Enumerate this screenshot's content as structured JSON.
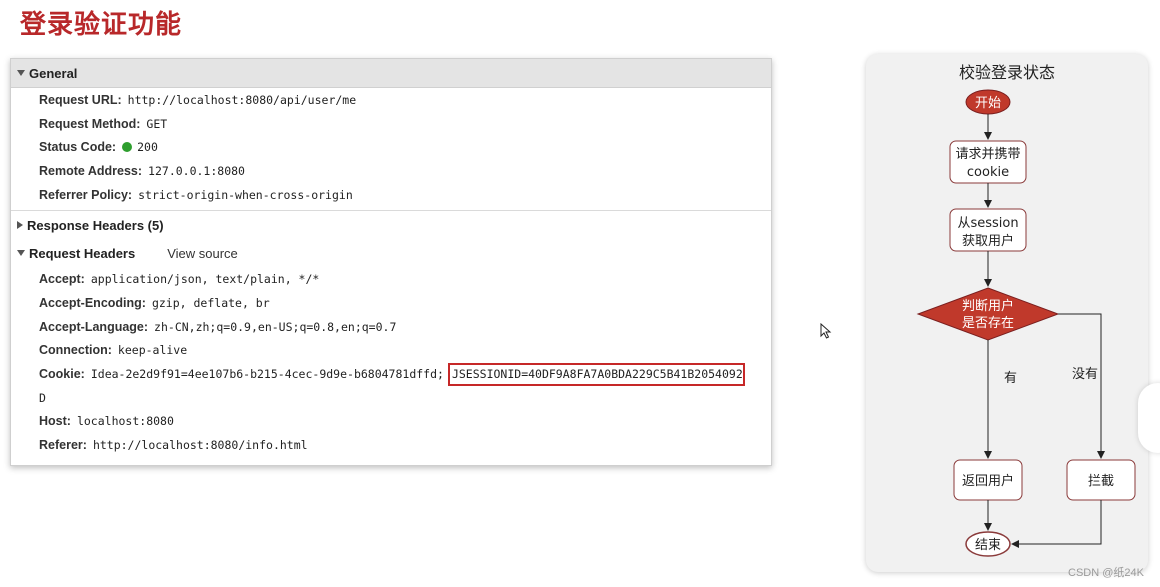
{
  "slide": {
    "title": "登录验证功能"
  },
  "devtools": {
    "general": {
      "title": "General",
      "rows": [
        {
          "key": "Request URL:",
          "value": "http://localhost:8080/api/user/me"
        },
        {
          "key": "Request Method:",
          "value": "GET"
        },
        {
          "key": "Status Code:",
          "value": "200"
        },
        {
          "key": "Remote Address:",
          "value": "127.0.0.1:8080"
        },
        {
          "key": "Referrer Policy:",
          "value": "strict-origin-when-cross-origin"
        }
      ]
    },
    "response_headers": {
      "title": "Response Headers (5)"
    },
    "request_headers": {
      "title": "Request Headers",
      "view_source": "View source",
      "rows": [
        {
          "key": "Accept:",
          "value": "application/json, text/plain, */*"
        },
        {
          "key": "Accept-Encoding:",
          "value": "gzip, deflate, br"
        },
        {
          "key": "Accept-Language:",
          "value": "zh-CN,zh;q=0.9,en-US;q=0.8,en;q=0.7"
        },
        {
          "key": "Connection:",
          "value": "keep-alive"
        },
        {
          "key": "Cookie:",
          "value": "Idea-2e2d9f91=4ee107b6-b215-4cec-9d9e-b6804781dffd;",
          "highlight": "JSESSIONID=40DF9A8FA7A0BDA229C5B41B2054092",
          "wrap": "D"
        },
        {
          "key": "Host:",
          "value": "localhost:8080"
        },
        {
          "key": "Referer:",
          "value": "http://localhost:8080/info.html"
        }
      ]
    }
  },
  "flowchart": {
    "title": "校验登录状态",
    "start": "开始",
    "step1": [
      "请求并携带",
      "cookie"
    ],
    "step2": [
      "从session",
      "获取用户"
    ],
    "decision": [
      "判断用户",
      "是否存在"
    ],
    "yes_label": "有",
    "no_label": "没有",
    "return_user": "返回用户",
    "intercept": "拦截",
    "end": "结束"
  },
  "colors": {
    "title_red": "#b8282a",
    "node_red": "#c0392b",
    "status_green": "#2e9e2e",
    "highlight_border": "#c62828"
  },
  "watermark": "CSDN @纸24K"
}
